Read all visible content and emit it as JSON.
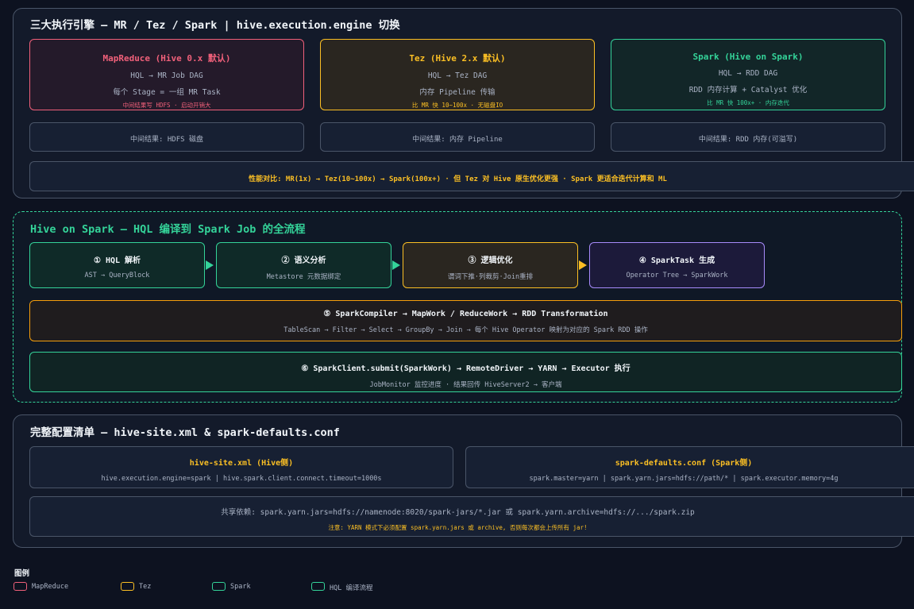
{
  "section1": {
    "title": "三大执行引擎 — MR / Tez / Spark | hive.execution.engine 切换",
    "engines": [
      {
        "title": "MapReduce (Hive 0.x 默认)",
        "line1": "HQL → MR Job DAG",
        "line2": "每个 Stage = 一组 MR Task",
        "note": "中间结果写 HDFS · 启动开销大",
        "intermediate": "中间结果: HDFS 磁盘",
        "color": "#f0607a"
      },
      {
        "title": "Tez (Hive 2.x 默认)",
        "line1": "HQL → Tez DAG",
        "line2": "内存 Pipeline 传输",
        "note": "比 MR 快 10~100x · 无磁盘IO",
        "intermediate": "中间结果: 内存 Pipeline",
        "color": "#fbbf24"
      },
      {
        "title": "Spark (Hive on Spark)",
        "line1": "HQL → RDD DAG",
        "line2": "RDD 内存计算 + Catalyst 优化",
        "note": "比 MR 快 100x+ · 内存迭代",
        "intermediate": "中间结果: RDD 内存(可溢写)",
        "color": "#34d399"
      }
    ],
    "perf": "性能对比: MR(1x) → Tez(10~100x) → Spark(100x+) · 但 Tez 对 Hive 原生优化更强 · Spark 更适合迭代计算和 ML"
  },
  "section2": {
    "title": "Hive on Spark — HQL 编译到 Spark Job 的全流程",
    "steps": [
      {
        "title": "① HQL 解析",
        "sub": "AST → QueryBlock"
      },
      {
        "title": "② 语义分析",
        "sub": "Metastore 元数据绑定"
      },
      {
        "title": "③ 逻辑优化",
        "sub": "谓词下推·列裁剪·Join重排"
      },
      {
        "title": "④ SparkTask 生成",
        "sub": "Operator Tree → SparkWork"
      }
    ],
    "step5": {
      "title": "⑤ SparkCompiler → MapWork / ReduceWork → RDD Transformation",
      "sub": "TableScan → Filter → Select → GroupBy → Join → 每个 Hive Operator 映射为对应的 Spark RDD 操作"
    },
    "step6": {
      "title": "⑥ SparkClient.submit(SparkWork) → RemoteDriver → YARN → Executor 执行",
      "sub": "JobMonitor 监控进度 · 结果回传 HiveServer2 → 客户端"
    }
  },
  "section3": {
    "title": "完整配置清单 — hive-site.xml & spark-defaults.conf",
    "hive": {
      "title": "hive-site.xml (Hive侧)",
      "body": "hive.execution.engine=spark | hive.spark.client.connect.timeout=1000s"
    },
    "spark": {
      "title": "spark-defaults.conf (Spark侧)",
      "body": "spark.master=yarn | spark.yarn.jars=hdfs://path/* | spark.executor.memory=4g"
    },
    "shared": "共享依赖: spark.yarn.jars=hdfs://namenode:8020/spark-jars/*.jar 或 spark.yarn.archive=hdfs://.../spark.zip",
    "warning": "注意: YARN 模式下必须配置 spark.yarn.jars 或 archive, 否则每次都会上传所有 jar!"
  },
  "legend": {
    "title": "图例",
    "items": [
      {
        "label": "MapReduce",
        "color": "#f0607a"
      },
      {
        "label": "Tez",
        "color": "#fbbf24"
      },
      {
        "label": "Spark",
        "color": "#34d399"
      },
      {
        "label": "HQL 编译流程",
        "color": "#34d399"
      }
    ]
  }
}
